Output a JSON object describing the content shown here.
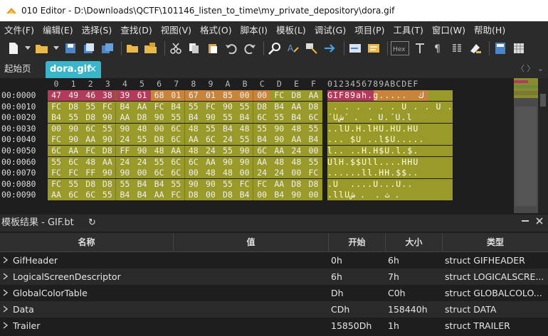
{
  "title": "010 Editor - D:\\Downloads\\QCTF\\101146_listen_to_time\\my_private_depository\\dora.gif",
  "menu": [
    "文件(F)",
    "编辑(E)",
    "选择(S)",
    "查找(D)",
    "视图(V)",
    "格式(O)",
    "脚本(I)",
    "模板(L)",
    "调试(G)",
    "项目(P)",
    "工具(T)",
    "窗口(W)",
    "帮助(H)"
  ],
  "tabs": {
    "home": "起始页",
    "active": "dora.gif",
    "close": "×",
    "nav": "〈 〉 ⌄"
  },
  "hex": {
    "columns": [
      "0",
      "1",
      "2",
      "3",
      "4",
      "5",
      "6",
      "7",
      "8",
      "9",
      "A",
      "B",
      "C",
      "D",
      "E",
      "F"
    ],
    "char_columns": "0123456789ABCDEF",
    "rows": [
      {
        "addr": "00:0000",
        "bytes": [
          "47",
          "49",
          "46",
          "38",
          "39",
          "61",
          "68",
          "01",
          "67",
          "01",
          "85",
          "00",
          "00",
          "FC",
          "D8",
          "AA"
        ],
        "chars": "GIF89ah.g.....  ك"
      },
      {
        "addr": "00:0010",
        "bytes": [
          "FC",
          "D8",
          "55",
          "FC",
          "B4",
          "AA",
          "FC",
          "B4",
          "55",
          "FC",
          "90",
          "55",
          "D8",
          "B4",
          "AA",
          "D8"
        ],
        "chars": " . . . . . . U . . U . . ش"
      },
      {
        "addr": "00:0020",
        "bytes": [
          "B4",
          "55",
          "D8",
          "90",
          "AA",
          "D8",
          "90",
          "55",
          "B4",
          "90",
          "55",
          "B4",
          "6C",
          "55",
          "B4",
          "6C"
        ],
        "chars": "´Uش´ .  . U.´U.l"
      },
      {
        "addr": "00:0030",
        "bytes": [
          "00",
          "90",
          "6C",
          "55",
          "90",
          "48",
          "00",
          "6C",
          "48",
          "55",
          "B4",
          "48",
          "55",
          "90",
          "48",
          "55"
        ],
        "chars": "..lU.H.lHU.HU.HU"
      },
      {
        "addr": "00:0040",
        "bytes": [
          "FC",
          "90",
          "AA",
          "90",
          "24",
          "55",
          "D8",
          "6C",
          "AA",
          "6C",
          "24",
          "55",
          "B4",
          "90",
          "AA",
          "B4"
        ],
        "chars": "... $U ..l$U....."
      },
      {
        "addr": "00:0050",
        "bytes": [
          "6C",
          "AA",
          "FC",
          "D8",
          "FF",
          "90",
          "48",
          "AA",
          "48",
          "24",
          "55",
          "90",
          "6C",
          "AA",
          "24",
          "00"
        ],
        "chars": "l.. ..H.H$U.l.$."
      },
      {
        "addr": "00:0060",
        "bytes": [
          "55",
          "6C",
          "48",
          "AA",
          "24",
          "24",
          "55",
          "6C",
          "6C",
          "AA",
          "90",
          "90",
          "AA",
          "48",
          "48",
          "55"
        ],
        "chars": "UlH.$$Ull....HHU"
      },
      {
        "addr": "00:0070",
        "bytes": [
          "FC",
          "FC",
          "FF",
          "90",
          "90",
          "00",
          "6C",
          "6C",
          "00",
          "48",
          "48",
          "00",
          "24",
          "24",
          "00",
          "FC"
        ],
        "chars": "......ll.HH.$$.."
      },
      {
        "addr": "00:0080",
        "bytes": [
          "FC",
          "55",
          "D8",
          "D8",
          "55",
          "B4",
          "B4",
          "55",
          "90",
          "90",
          "55",
          "FC",
          "FC",
          "AA",
          "D8",
          "D8"
        ],
        "chars": ".U  ....U...U.."
      },
      {
        "addr": "00:0090",
        "bytes": [
          "AA",
          "6C",
          "6C",
          "55",
          "B4",
          "B4",
          "AA",
          "FC",
          "D8",
          "00",
          "D8",
          "B4",
          "00",
          "B4",
          "90",
          "00"
        ],
        "chars": ".llUث .  . ش ."
      }
    ]
  },
  "template": {
    "title": "模板结果 - GIF.bt",
    "refresh_icon": "↻",
    "columns": [
      "名称",
      "值",
      "开始",
      "大小",
      "类型"
    ],
    "rows": [
      {
        "name": "GifHeader",
        "value": "",
        "start": "0h",
        "size": "6h",
        "type": "struct GIFHEADER"
      },
      {
        "name": "LogicalScreenDescriptor",
        "value": "",
        "start": "6h",
        "size": "7h",
        "type": "struct LOGICALSCRE..."
      },
      {
        "name": "GlobalColorTable",
        "value": "",
        "start": "Dh",
        "size": "C0h",
        "type": "struct GLOBALCOLO..."
      },
      {
        "name": "Data",
        "value": "",
        "start": "CDh",
        "size": "158440h",
        "type": "struct DATA"
      },
      {
        "name": "Trailer",
        "value": "",
        "start": "15850Dh",
        "size": "1h",
        "type": "struct TRAILER"
      }
    ]
  },
  "colors": {
    "accent": "#3bb5c9",
    "header_red": "#b23a5a",
    "header_orange": "#c8843a",
    "data_olive": "#9a9a2a"
  }
}
